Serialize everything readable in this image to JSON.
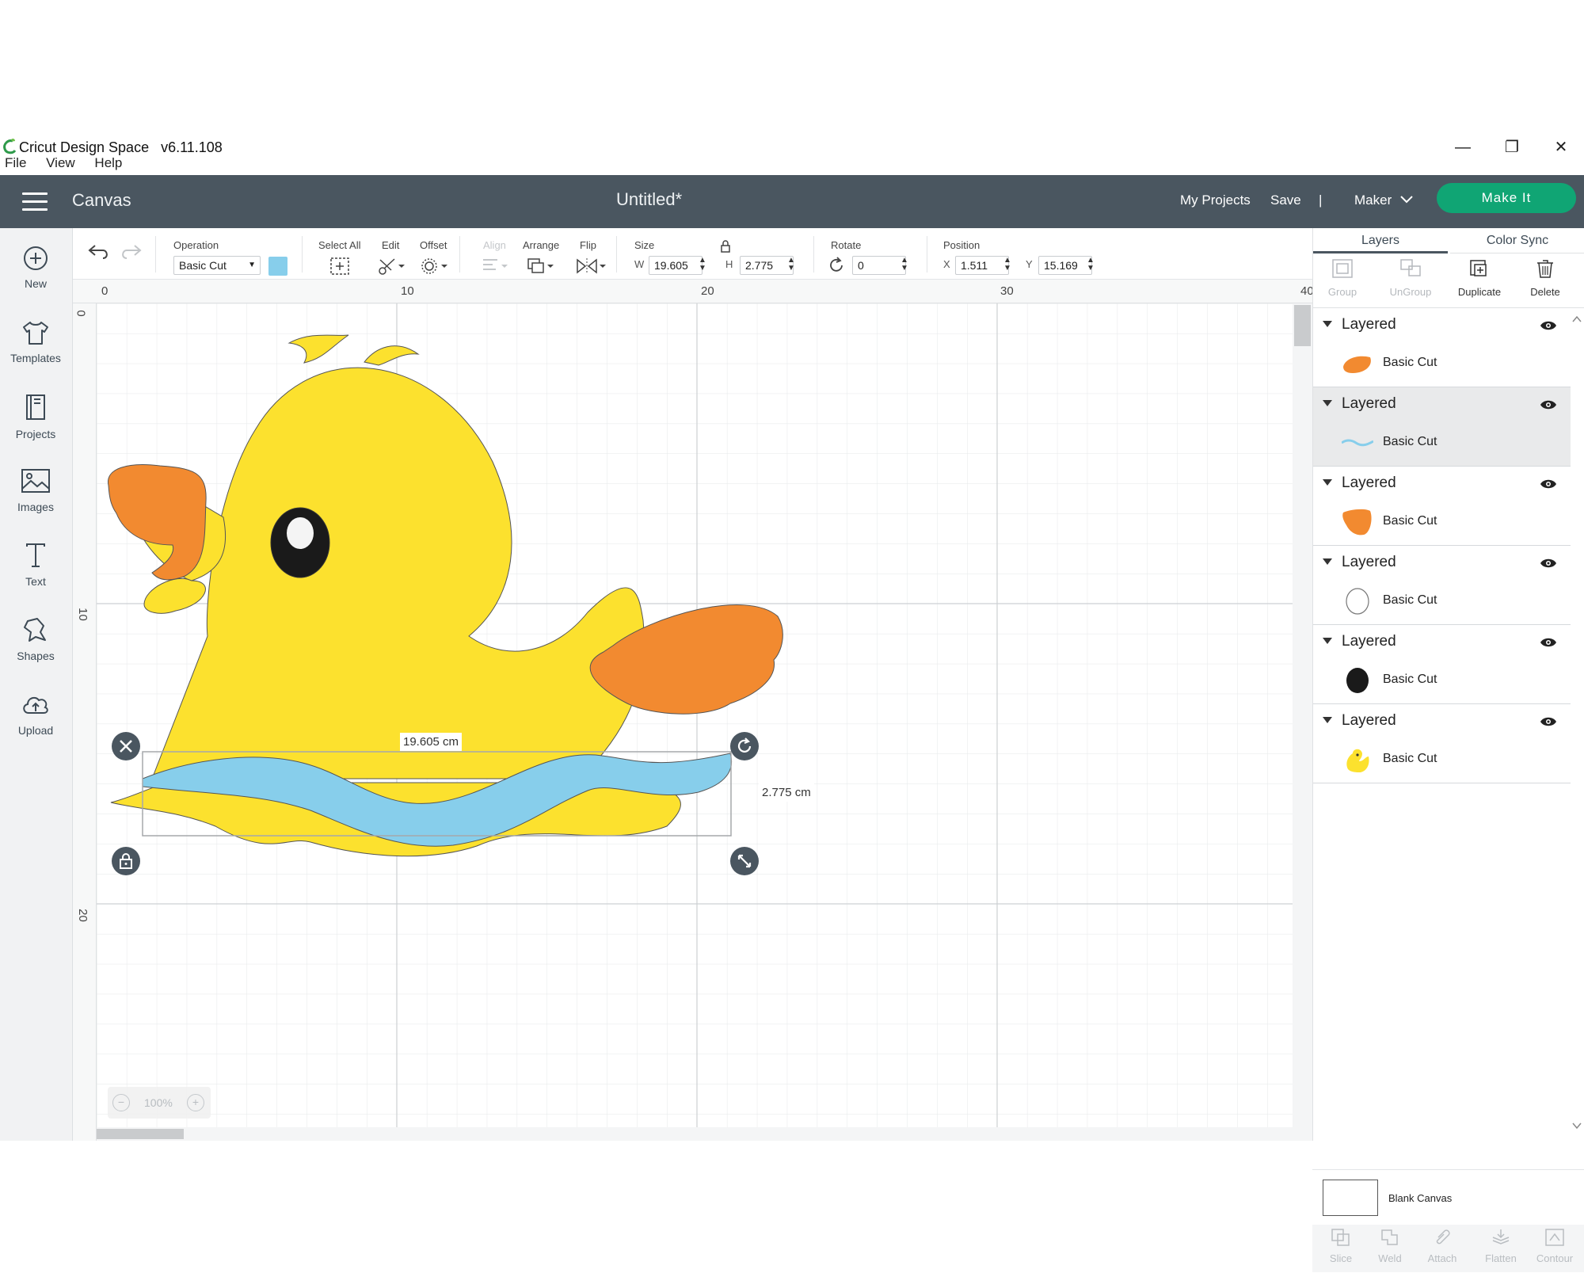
{
  "titlebar": {
    "app_title": "Cricut Design Space   v6.11.108",
    "minimize": "—",
    "restore": "❐",
    "close": "✕"
  },
  "menu": [
    "File",
    "View",
    "Help"
  ],
  "header": {
    "section": "Canvas",
    "document_title": "Untitled*",
    "my_projects": "My Projects",
    "save": "Save",
    "divider": "|",
    "machine": "Maker",
    "make_it": "Make It"
  },
  "sidebar": [
    {
      "label": "New",
      "icon": "plus-circle-icon"
    },
    {
      "label": "Templates",
      "icon": "tshirt-icon"
    },
    {
      "label": "Projects",
      "icon": "book-icon"
    },
    {
      "label": "Images",
      "icon": "image-icon"
    },
    {
      "label": "Text",
      "icon": "text-icon"
    },
    {
      "label": "Shapes",
      "icon": "shapes-icon"
    },
    {
      "label": "Upload",
      "icon": "cloud-upload-icon"
    }
  ],
  "toolbar": {
    "operation_label": "Operation",
    "operation_value": "Basic Cut",
    "operation_color": "#87ceeb",
    "select_all": "Select All",
    "edit": "Edit",
    "offset": "Offset",
    "align": "Align",
    "arrange": "Arrange",
    "flip": "Flip",
    "size": "Size",
    "w_label": "W",
    "w_value": "19.605",
    "h_label": "H",
    "h_value": "2.775",
    "rotate": "Rotate",
    "rotate_value": "0",
    "position": "Position",
    "x_label": "X",
    "x_value": "1.511",
    "y_label": "Y",
    "y_value": "15.169"
  },
  "ruler": {
    "top": [
      "0",
      "10",
      "20",
      "30",
      "40"
    ],
    "left": [
      "0",
      "10",
      "20"
    ]
  },
  "canvas": {
    "width_label": "19.605 cm",
    "height_label": "2.775 cm",
    "zoom": "100%",
    "colors": {
      "yellow": "#fce12e",
      "orange": "#f28a30",
      "blue": "#87ceeb",
      "black": "#1a1a1a"
    }
  },
  "panel": {
    "tabs": [
      "Layers",
      "Color Sync"
    ],
    "actions": [
      {
        "label": "Group",
        "enabled": false
      },
      {
        "label": "UnGroup",
        "enabled": false
      },
      {
        "label": "Duplicate",
        "enabled": true
      },
      {
        "label": "Delete",
        "enabled": true
      }
    ],
    "groups": [
      {
        "name": "Layered",
        "layer": "Basic Cut",
        "thumb": "orange-beak",
        "selected": false
      },
      {
        "name": "Layered",
        "layer": "Basic Cut",
        "thumb": "blue-wave",
        "selected": true
      },
      {
        "name": "Layered",
        "layer": "Basic Cut",
        "thumb": "orange-wing",
        "selected": false
      },
      {
        "name": "Layered",
        "layer": "Basic Cut",
        "thumb": "white-eye",
        "selected": false
      },
      {
        "name": "Layered",
        "layer": "Basic Cut",
        "thumb": "black-pupil",
        "selected": false
      },
      {
        "name": "Layered",
        "layer": "Basic Cut",
        "thumb": "yellow-duck",
        "selected": false
      }
    ],
    "blank_canvas": "Blank Canvas",
    "bottom_tools": [
      "Slice",
      "Weld",
      "Attach",
      "Flatten",
      "Contour"
    ]
  }
}
